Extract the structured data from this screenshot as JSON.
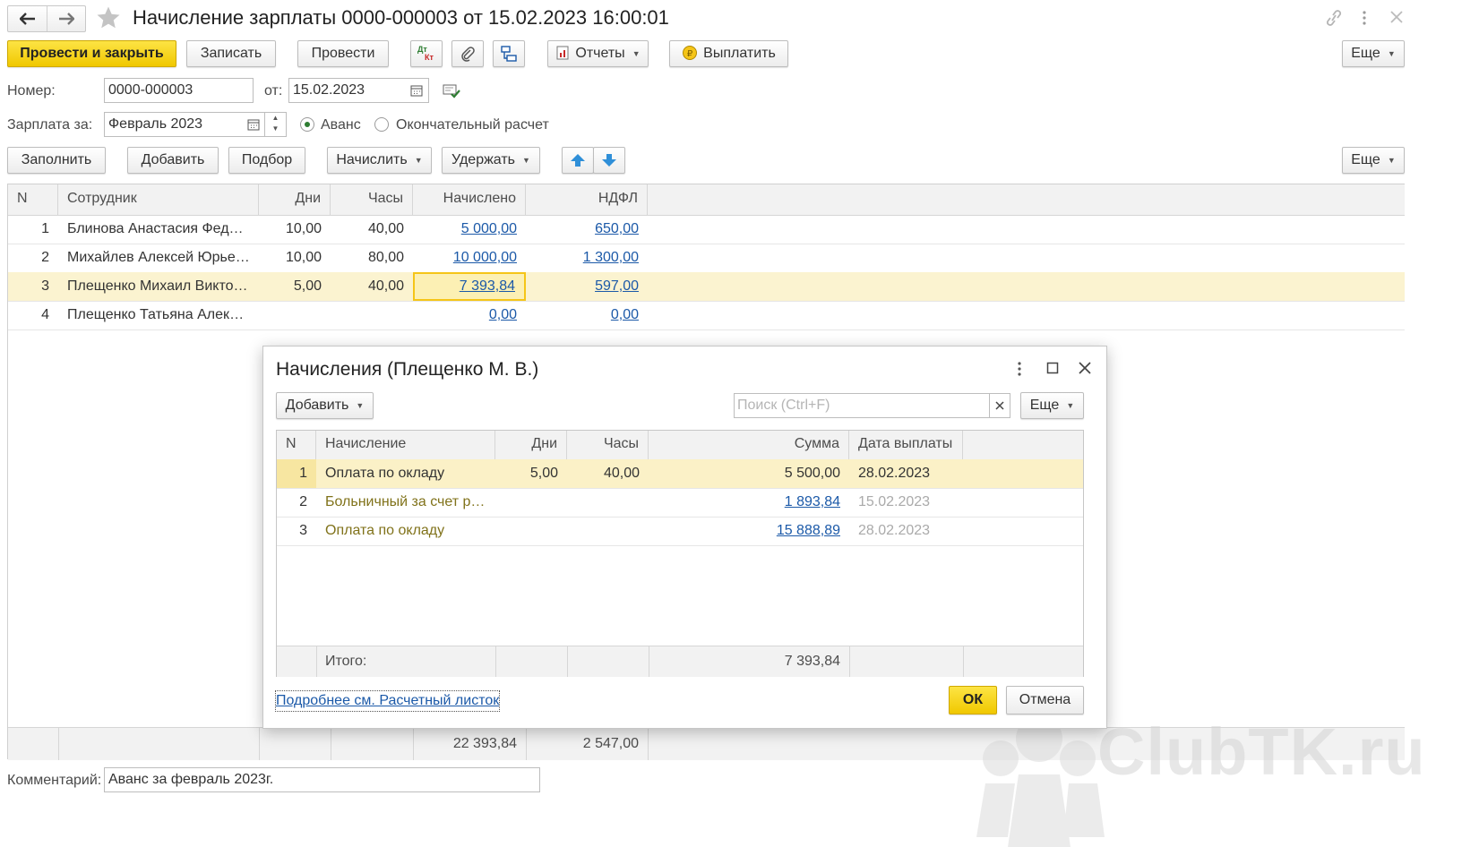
{
  "window": {
    "title": "Начисление зарплаты 0000-000003 от 15.02.2023 16:00:01"
  },
  "toolbar": {
    "post_close": "Провести и закрыть",
    "save": "Записать",
    "post": "Провести",
    "dt_kt_line1": "Дт",
    "dt_kt_line2": "Кт",
    "reports": "Отчеты",
    "pay": "Выплатить",
    "more": "Еще"
  },
  "header": {
    "number_label": "Номер:",
    "number_value": "0000-000003",
    "date_label": "от:",
    "date_value": "15.02.2023",
    "period_label": "Зарплата за:",
    "period_value": "Февраль 2023",
    "advance_label": "Аванс",
    "final_label": "Окончательный расчет",
    "advance_selected": true
  },
  "table_toolbar": {
    "fill": "Заполнить",
    "add": "Добавить",
    "pick": "Подбор",
    "accrue": "Начислить",
    "withhold": "Удержать",
    "more": "Еще"
  },
  "main_table": {
    "columns": [
      "N",
      "Сотрудник",
      "Дни",
      "Часы",
      "Начислено",
      "НДФЛ"
    ],
    "rows": [
      {
        "n": "1",
        "employee": "Блинова Анастасия Фед…",
        "days": "10,00",
        "hours": "40,00",
        "accrued": "5 000,00",
        "ndfl": "650,00"
      },
      {
        "n": "2",
        "employee": "Михайлев Алексей Юрье…",
        "days": "10,00",
        "hours": "80,00",
        "accrued": "10 000,00",
        "ndfl": "1 300,00"
      },
      {
        "n": "3",
        "employee": "Плещенко Михаил Виктор…",
        "days": "5,00",
        "hours": "40,00",
        "accrued": "7 393,84",
        "ndfl": "597,00"
      },
      {
        "n": "4",
        "employee": "Плещенко Татьяна Алекс…",
        "days": "",
        "hours": "",
        "accrued": "0,00",
        "ndfl": "0,00"
      }
    ],
    "totals": {
      "accrued": "22 393,84",
      "ndfl": "2 547,00"
    }
  },
  "comment": {
    "label": "Комментарий:",
    "value": "Аванс за февраль 2023г."
  },
  "dialog": {
    "title": "Начисления (Плещенко М. В.)",
    "add": "Добавить",
    "search_placeholder": "Поиск (Ctrl+F)",
    "more": "Еще",
    "columns": [
      "N",
      "Начисление",
      "Дни",
      "Часы",
      "Сумма",
      "Дата выплаты"
    ],
    "rows": [
      {
        "n": "1",
        "name": "Оплата по окладу",
        "days": "5,00",
        "hours": "40,00",
        "sum": "5 500,00",
        "date": "28.02.2023"
      },
      {
        "n": "2",
        "name": "Больничный за счет р…",
        "days": "",
        "hours": "",
        "sum": "1 893,84",
        "date": "15.02.2023"
      },
      {
        "n": "3",
        "name": "Оплата по окладу",
        "days": "",
        "hours": "",
        "sum": "15 888,89",
        "date": "28.02.2023"
      }
    ],
    "total_label": "Итого:",
    "total_sum": "7 393,84",
    "details_link": "Подробнее см. Расчетный листок",
    "ok": "ОК",
    "cancel": "Отмена"
  },
  "watermark": "ClubTK.ru",
  "colors": {
    "accent_yellow": "#f5d20a",
    "selected_row": "#fbf3d0",
    "link": "#1b59a8"
  }
}
